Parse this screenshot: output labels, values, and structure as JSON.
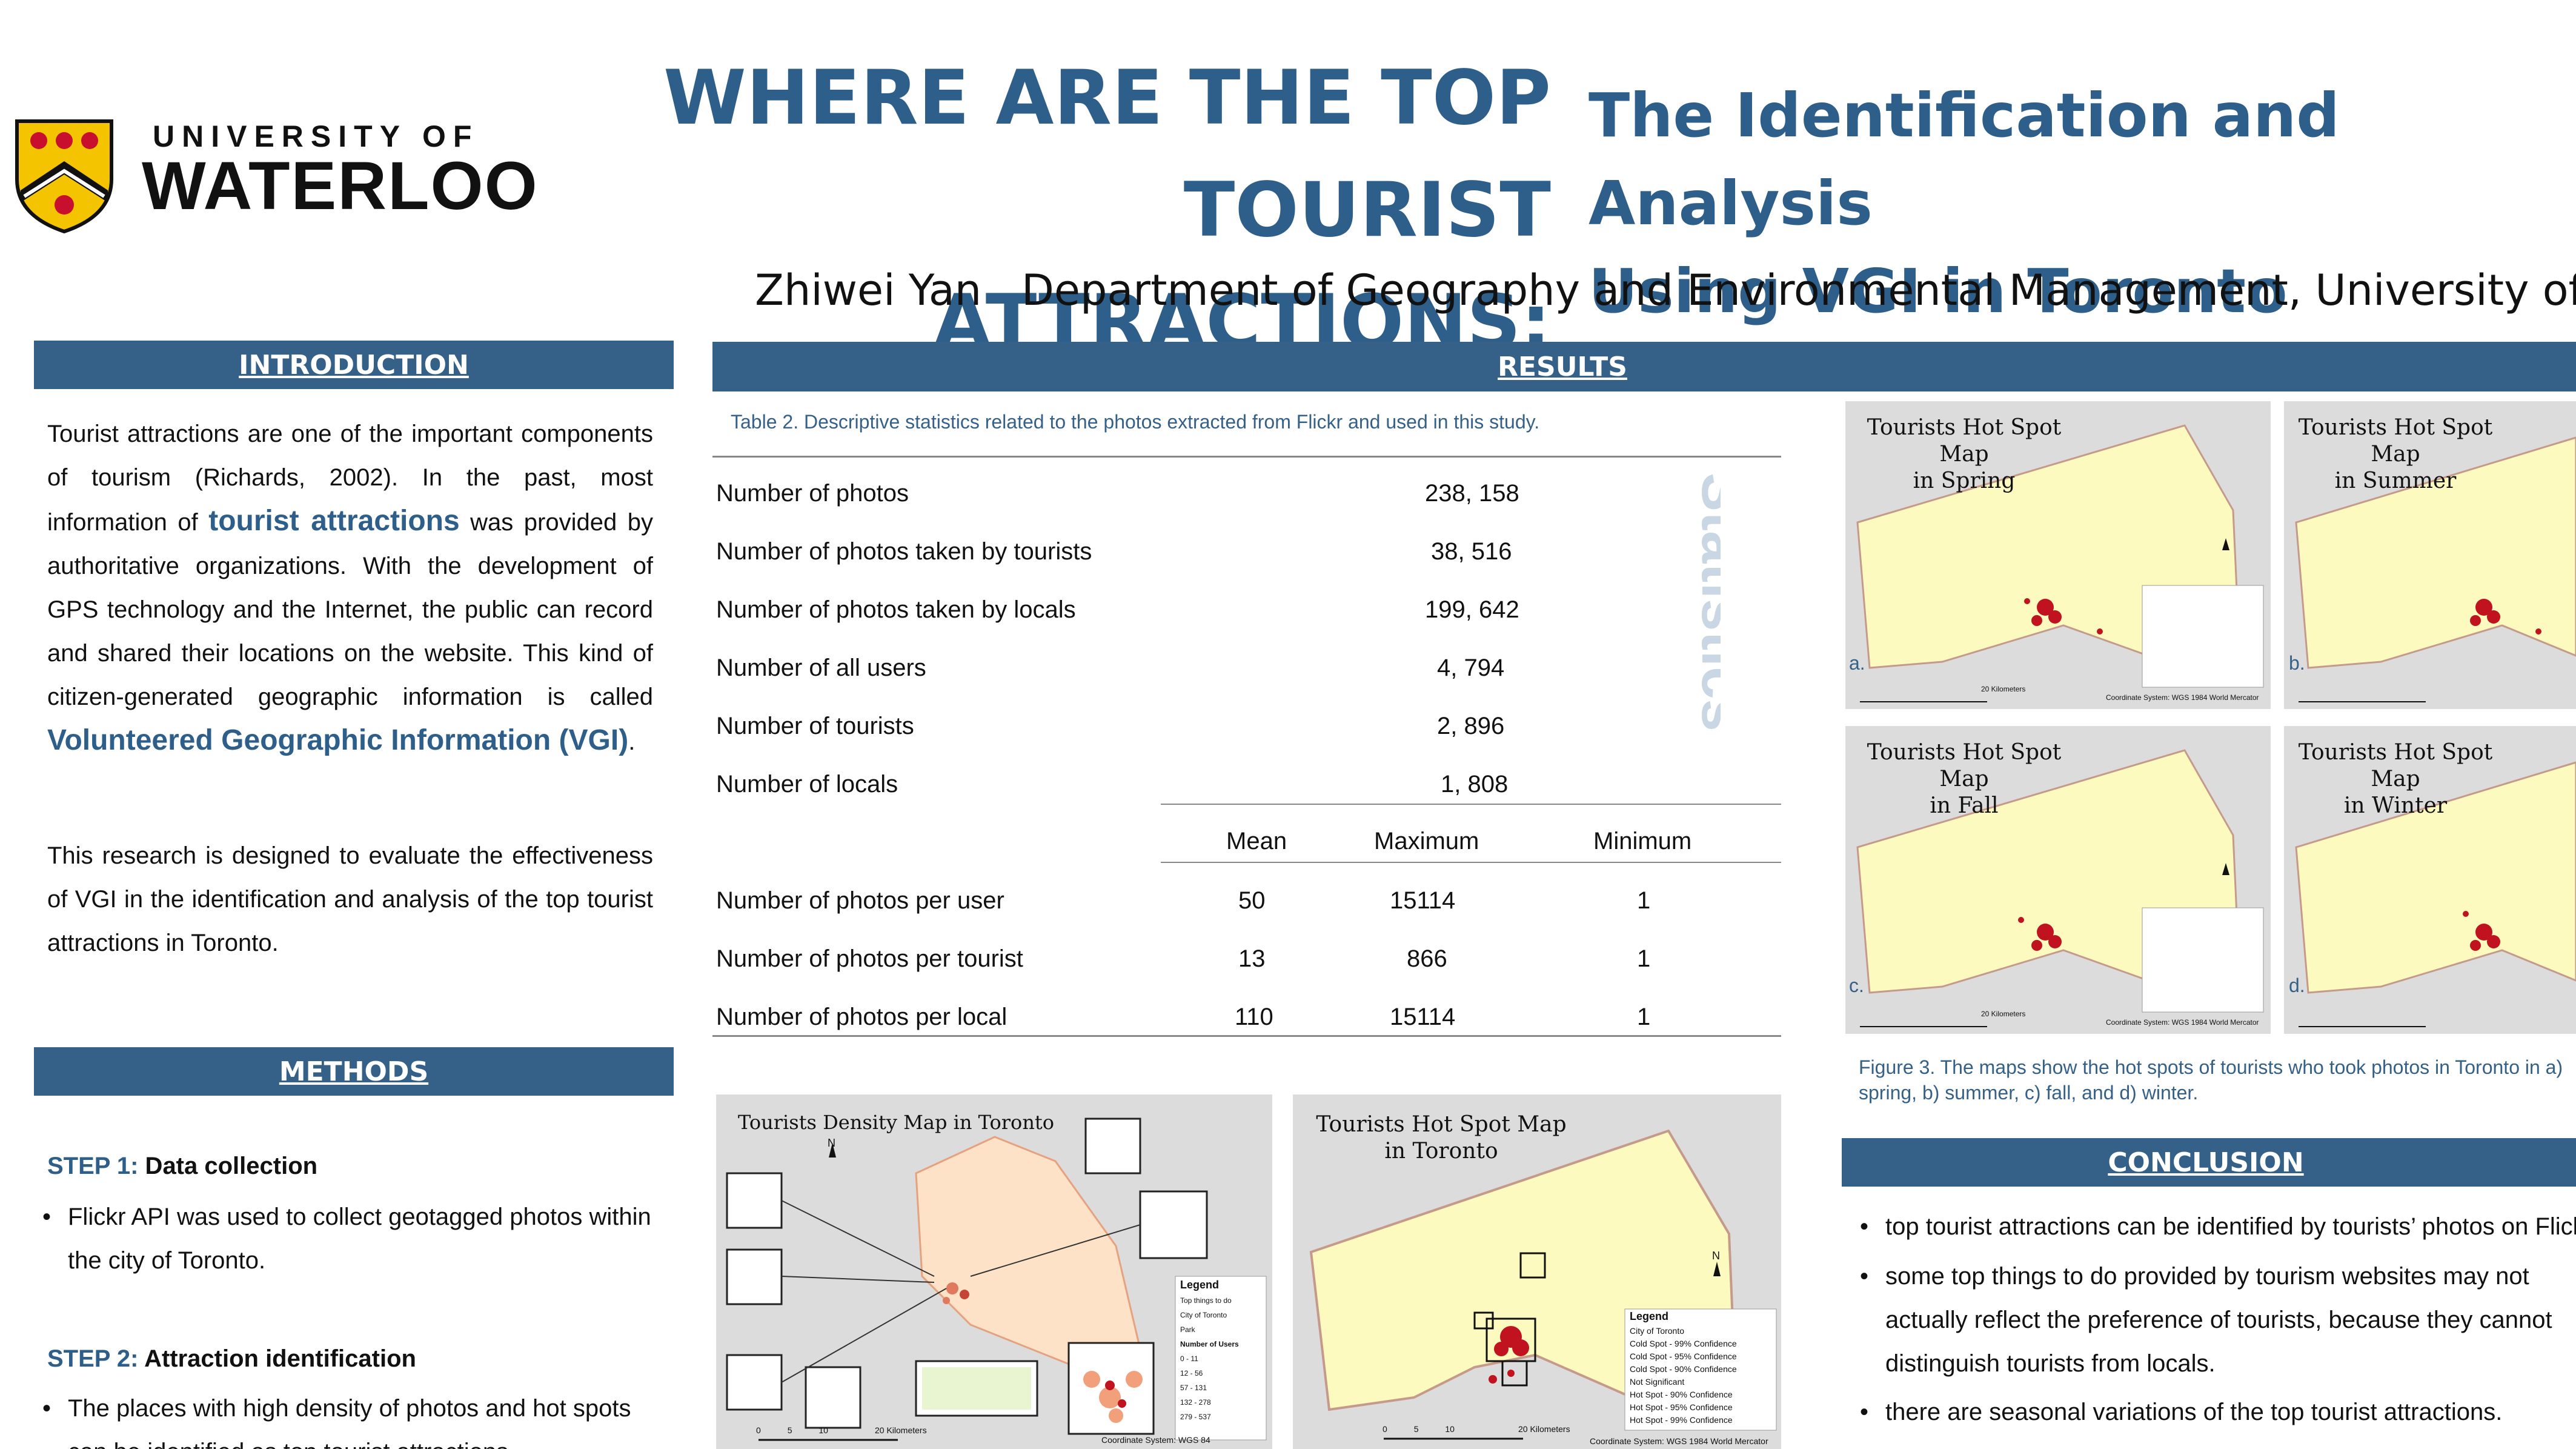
{
  "header": {
    "logo": {
      "top": "UNIVERSITY OF",
      "bottom": "WATERLOO"
    },
    "title_line1": "WHERE ARE THE TOP",
    "title_line2": "TOURIST ATTRACTIONS:",
    "subtitle_line1": "The Identification and Analysis",
    "subtitle_line2": "Using VGI in Toronto",
    "author": "Zhiwei Yan",
    "department": "Department of Geography and Environmental Management, University of Waterloo"
  },
  "introduction": {
    "heading": "INTRODUCTION",
    "p1_a": "Tourist attractions are one of the important components of tourism (Richards, 2002). In the past, most information of ",
    "p1_hl": "tourist attractions",
    "p1_b": " was provided by authoritative organizations. With the development of GPS technology and the Internet, the public can record and shared their locations on the website. This kind of citizen-generated geographic information is called ",
    "p1_hl2": "Volunteered Geographic Information (VGI)",
    "p1_c": ".",
    "p2": "This research is designed to evaluate the effectiveness of VGI in the identification and analysis of the top tourist attractions in Toronto."
  },
  "methods": {
    "heading": "METHODS",
    "step1_num": "STEP 1:",
    "step1_title": " Data collection",
    "step1_bullet": "Flickr API was used to collect geotagged photos within the city of Toronto.",
    "step2_num": "STEP 2:",
    "step2_title": " Attraction identification",
    "step2_bullet": "The places with high density of photos and hot spots can be identified as top tourist attractions."
  },
  "results": {
    "heading": "RESULTS",
    "table_caption": "Table 2. Descriptive statistics related to the photos extracted from Flickr and used in this study.",
    "side_label": "Statistics",
    "rows": [
      {
        "label": "Number of photos",
        "value": "238, 158"
      },
      {
        "label": "Number of photos taken by tourists",
        "value": "38, 516"
      },
      {
        "label": "Number of photos taken by locals",
        "value": "199, 642"
      },
      {
        "label": "Number of all users",
        "value": "4, 794"
      },
      {
        "label": "Number of tourists",
        "value": "2, 896"
      },
      {
        "label": "Number of locals",
        "value": "1, 808"
      }
    ],
    "stat_headers": {
      "mean": "Mean",
      "max": "Maximum",
      "min": "Minimum"
    },
    "stat_rows": [
      {
        "label": "Number of photos per user",
        "mean": "50",
        "max": "15114",
        "min": "1"
      },
      {
        "label": "Number of photos per tourist",
        "mean": "13",
        "max": "866",
        "min": "1"
      },
      {
        "label": "Number of photos per local",
        "mean": "110",
        "max": "15114",
        "min": "1"
      }
    ],
    "density_map": {
      "title": "Tourists Density Map in Toronto",
      "north": "N",
      "legend_title": "Legend",
      "legend_items": [
        "Top things to do",
        "City of Toronto",
        "Park",
        "Number of Users",
        "0 - 11",
        "12 - 56",
        "57 - 131",
        "132 - 278",
        "279 - 537"
      ],
      "scale": "20 Kilometers",
      "scale_ticks": [
        "0",
        "5",
        "10"
      ],
      "coord": "Coordinate System: WGS 84"
    },
    "hotspot_map": {
      "title_line1": "Tourists Hot Spot Map",
      "title_line2": "in Toronto",
      "north": "N",
      "legend_title": "Legend",
      "legend_items": [
        "City of Toronto",
        "Cold Spot - 99% Confidence",
        "Cold Spot - 95% Confidence",
        "Cold Spot - 90% Confidence",
        "Not Significant",
        "Hot Spot - 90% Confidence",
        "Hot Spot - 95% Confidence",
        "Hot Spot - 99% Confidence"
      ],
      "scale": "20 Kilometers",
      "scale_ticks": [
        "0",
        "5",
        "10"
      ],
      "coord": "Coordinate System: WGS 1984 World Mercator"
    },
    "season_maps": [
      {
        "title_line1": "Tourists Hot Spot Map",
        "title_line2": "in Spring",
        "letter": "a."
      },
      {
        "title_line1": "Tourists Hot Spot Map",
        "title_line2": "in Summer",
        "letter": "b."
      },
      {
        "title_line1": "Tourists Hot Spot Map",
        "title_line2": "in Fall",
        "letter": "c."
      },
      {
        "title_line1": "Tourists Hot Spot Map",
        "title_line2": "in Winter",
        "letter": "d."
      }
    ],
    "season_scale": "20 Kilometers",
    "season_coord": "Coordinate System: WGS 1984 World Mercator",
    "figure_caption": "Figure 3. The maps show the hot spots of tourists who took photos in Toronto in a) spring, b) summer, c) fall, and d) winter."
  },
  "conclusion": {
    "heading": "CONCLUSION",
    "b1": "top tourist attractions can be identified by tourists’ photos on Flickr.",
    "b2": "some top things to do provided by tourism websites may not actually reflect the preference of tourists, because they cannot distinguish tourists from locals.",
    "b3": "there are seasonal variations of the top tourist attractions."
  }
}
